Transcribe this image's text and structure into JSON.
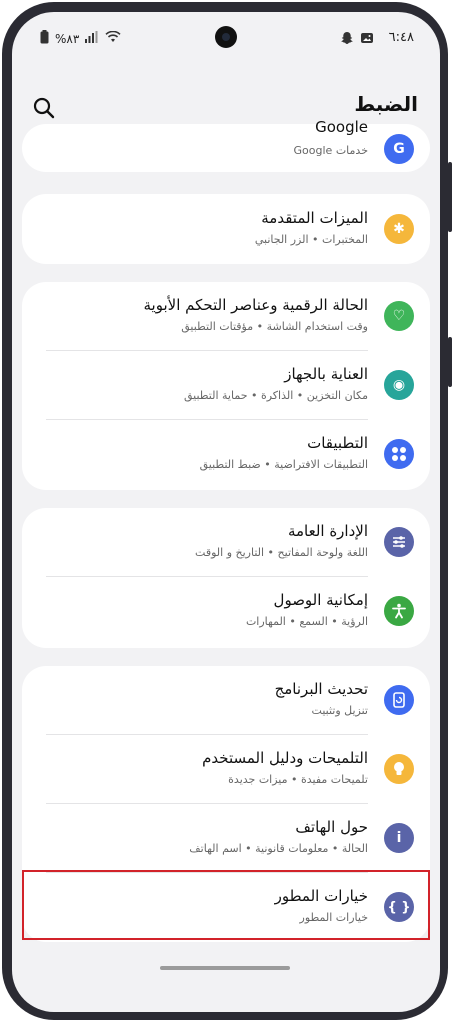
{
  "status": {
    "time": "٦:٤٨",
    "battery": "%٨٣"
  },
  "header": {
    "title": "الضبط"
  },
  "google": {
    "label": "Google",
    "sub": "خدمات Google"
  },
  "groups": [
    {
      "items": [
        {
          "label": "الميزات المتقدمة",
          "sub": "المختبرات • الزر الجانبي",
          "color": "#f5b73b"
        }
      ]
    },
    {
      "items": [
        {
          "label": "الحالة الرقمية وعناصر التحكم الأبوية",
          "sub": "وقت استخدام الشاشة • مؤقتات التطبيق",
          "color": "#3fb55a"
        },
        {
          "label": "العناية بالجهاز",
          "sub": "مكان التخزين • الذاكرة • حماية التطبيق",
          "color": "#27a59a"
        },
        {
          "label": "التطبيقات",
          "sub": "التطبيقات الافتراضية • ضبط التطبيق",
          "color": "#3f6bf0"
        }
      ]
    },
    {
      "items": [
        {
          "label": "الإدارة العامة",
          "sub": "اللغة ولوحة المفاتيح • التاريخ و الوقت",
          "color": "#5a64a8"
        },
        {
          "label": "إمكانية الوصول",
          "sub": "الرؤية • السمع • المهارات",
          "color": "#3aa843"
        }
      ]
    },
    {
      "items": [
        {
          "label": "تحديث البرنامج",
          "sub": "تنزيل وتثبيت",
          "color": "#3f6bf0"
        },
        {
          "label": "التلميحات ودليل المستخدم",
          "sub": "تلميحات مفيدة • ميزات جديدة",
          "color": "#f5b73b"
        },
        {
          "label": "حول الهاتف",
          "sub": "الحالة • معلومات قانونية • اسم الهاتف",
          "color": "#5a64a8"
        },
        {
          "label": "خيارات المطور",
          "sub": "خيارات المطور",
          "color": "#5a64a8"
        }
      ]
    }
  ]
}
